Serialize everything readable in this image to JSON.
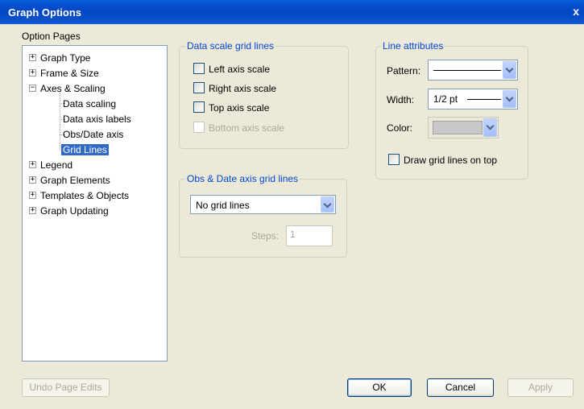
{
  "window": {
    "title": "Graph Options",
    "close_glyph": "x"
  },
  "option_pages": {
    "label": "Option Pages",
    "items": [
      {
        "label": "Graph Type",
        "expander": "+"
      },
      {
        "label": "Frame & Size",
        "expander": "+"
      },
      {
        "label": "Axes & Scaling",
        "expander": "−"
      },
      {
        "label": "Data scaling"
      },
      {
        "label": "Data axis labels"
      },
      {
        "label": "Obs/Date axis"
      },
      {
        "label": "Grid Lines",
        "selected": true
      },
      {
        "label": "Legend",
        "expander": "+"
      },
      {
        "label": "Graph Elements",
        "expander": "+"
      },
      {
        "label": "Templates & Objects",
        "expander": "+"
      },
      {
        "label": "Graph Updating",
        "expander": "+"
      }
    ]
  },
  "data_scale_grid": {
    "title": "Data scale grid lines",
    "left": "Left axis scale",
    "right": "Right axis scale",
    "top": "Top axis scale",
    "bottom": "Bottom axis scale"
  },
  "obs_date_grid": {
    "title": "Obs & Date axis grid lines",
    "selected": "No grid lines",
    "steps_label": "Steps:",
    "steps_value": "1"
  },
  "line_attributes": {
    "title": "Line attributes",
    "pattern_label": "Pattern:",
    "width_label": "Width:",
    "width_value": "1/2 pt",
    "color_label": "Color:",
    "color_value": "#c8c8c8",
    "draw_on_top": "Draw grid lines on top"
  },
  "buttons": {
    "undo": "Undo Page Edits",
    "ok": "OK",
    "cancel": "Cancel",
    "apply": "Apply"
  }
}
